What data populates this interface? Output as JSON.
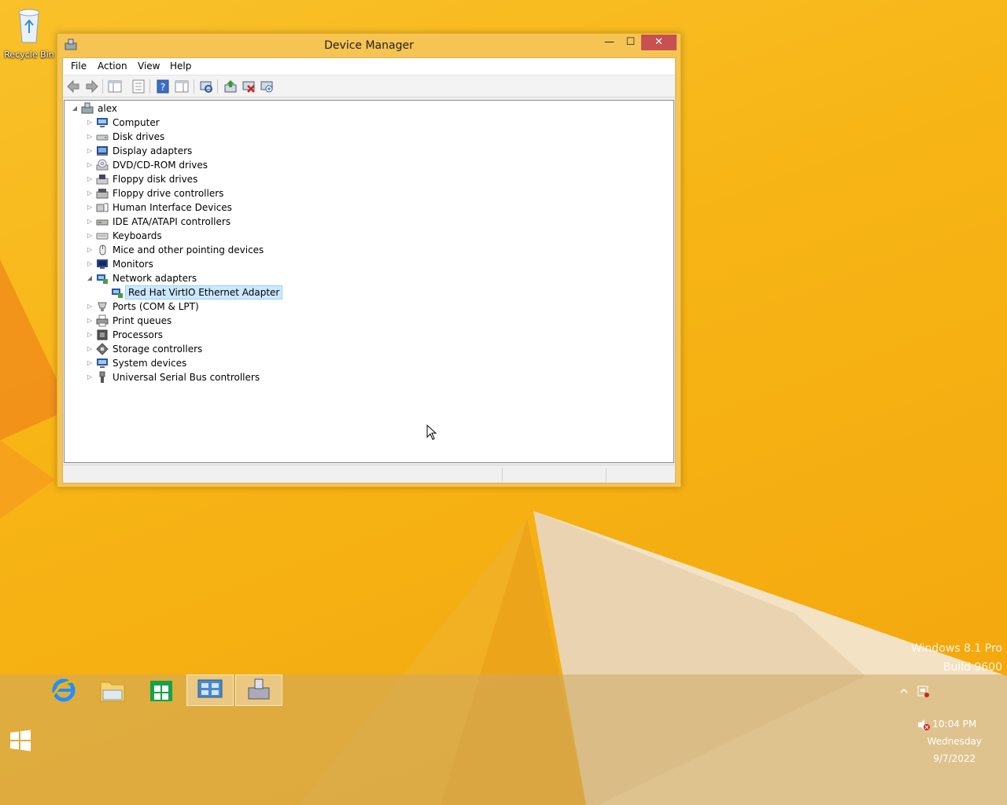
{
  "desktop": {
    "recycle_bin_label": "Recycle Bin",
    "watermark_line1": "Windows 8.1 Pro",
    "watermark_line2": "Build 9600"
  },
  "window": {
    "title": "Device Manager",
    "minimize_glyph": "—",
    "maximize_glyph": "☐",
    "close_glyph": "✕"
  },
  "menu": {
    "items": [
      {
        "label": "File"
      },
      {
        "label": "Action"
      },
      {
        "label": "View"
      },
      {
        "label": "Help"
      }
    ]
  },
  "toolbar": {
    "icons": [
      "back-arrow-icon",
      "forward-arrow-icon",
      "show-hide-console-tree-icon",
      "properties-icon",
      "help-icon",
      "show-action-pane-icon",
      "scan-hardware-changes-icon",
      "update-driver-icon",
      "uninstall-device-icon",
      "add-legacy-hardware-icon"
    ]
  },
  "tree": {
    "root": {
      "label": "alex",
      "expanded": true
    },
    "categories": [
      {
        "label": "Computer",
        "icon": "computer-icon"
      },
      {
        "label": "Disk drives",
        "icon": "disk-drive-icon"
      },
      {
        "label": "Display adapters",
        "icon": "display-adapter-icon"
      },
      {
        "label": "DVD/CD-ROM drives",
        "icon": "dvd-drive-icon"
      },
      {
        "label": "Floppy disk drives",
        "icon": "floppy-disk-icon"
      },
      {
        "label": "Floppy drive controllers",
        "icon": "floppy-controller-icon"
      },
      {
        "label": "Human Interface Devices",
        "icon": "hid-icon"
      },
      {
        "label": "IDE ATA/ATAPI controllers",
        "icon": "ide-controller-icon"
      },
      {
        "label": "Keyboards",
        "icon": "keyboard-icon"
      },
      {
        "label": "Mice and other pointing devices",
        "icon": "mouse-icon"
      },
      {
        "label": "Monitors",
        "icon": "monitor-icon"
      },
      {
        "label": "Network adapters",
        "icon": "network-adapter-icon",
        "expanded": true,
        "children": [
          {
            "label": "Red Hat VirtIO Ethernet Adapter",
            "icon": "ethernet-adapter-icon",
            "selected": true
          }
        ]
      },
      {
        "label": "Ports (COM & LPT)",
        "icon": "port-icon"
      },
      {
        "label": "Print queues",
        "icon": "printer-icon"
      },
      {
        "label": "Processors",
        "icon": "processor-icon"
      },
      {
        "label": "Storage controllers",
        "icon": "storage-controller-icon"
      },
      {
        "label": "System devices",
        "icon": "system-device-icon"
      },
      {
        "label": "Universal Serial Bus controllers",
        "icon": "usb-icon"
      }
    ]
  },
  "taskbar": {
    "pinned": [
      {
        "name": "internet-explorer-icon",
        "active": false
      },
      {
        "name": "file-explorer-icon",
        "active": false
      },
      {
        "name": "store-icon",
        "active": false
      },
      {
        "name": "control-panel-icon",
        "active": true
      },
      {
        "name": "device-manager-icon",
        "active": true
      }
    ],
    "clock": {
      "time": "10:04 PM",
      "day": "Wednesday",
      "date": "9/7/2022"
    }
  },
  "colors": {
    "wallpaper": "#f7b515",
    "window_frame": "#f6c453",
    "close_button": "#c75050",
    "selection": "#cce8ff"
  }
}
